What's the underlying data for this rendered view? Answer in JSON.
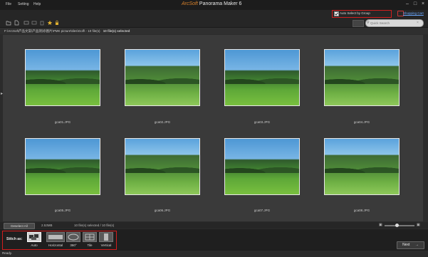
{
  "menu": [
    "File",
    "Setting",
    "Help"
  ],
  "app": {
    "brand": "ArcSoft",
    "title": "Panorama Maker 6"
  },
  "header": {
    "auto_select_label": "Auto Select by Group",
    "auto_select_checked": true,
    "shopping_cart": "Shopping Cart"
  },
  "search": {
    "placeholder": "Quick Search"
  },
  "path": {
    "folder": "F:\\ArcSoft产品文案\\产品测试\\图片\\PMK picture\\tiles\\Golf\\ - 10 file(s)",
    "selected": "10 file(s) selected"
  },
  "thumbnails": [
    {
      "name": "gca01.JPG"
    },
    {
      "name": "gca02.JPG"
    },
    {
      "name": "gca03.JPG"
    },
    {
      "name": "gca04.JPG"
    },
    {
      "name": "gca05.JPG"
    },
    {
      "name": "gca06.JPG"
    },
    {
      "name": "gca07.JPG"
    },
    {
      "name": "gca08.JPG"
    }
  ],
  "strip": {
    "deselect_label": "Deselect All",
    "size": "2.53MB",
    "selection": "10 file(s) selected / 10 file(s)"
  },
  "stitch": {
    "label": "Stitch as:",
    "modes": [
      {
        "label": "Auto",
        "active": true
      },
      {
        "label": "Horizontal",
        "active": false
      },
      {
        "label": "360°",
        "active": false
      },
      {
        "label": "Tile",
        "active": false
      },
      {
        "label": "Vertical",
        "active": false
      }
    ]
  },
  "next_label": "Next",
  "status": "Ready."
}
